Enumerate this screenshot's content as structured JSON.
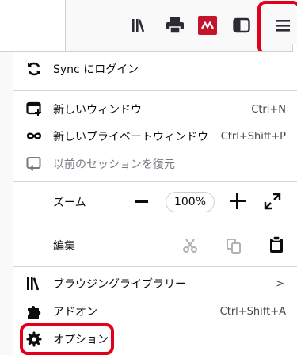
{
  "toolbar": {
    "icons": [
      "library-icon",
      "print-icon",
      "extension-badge-icon",
      "sidebar-icon",
      "hamburger-menu-icon"
    ],
    "colors": {
      "extension_badge": "#c4142c",
      "highlight": "#e0001b"
    }
  },
  "menu": {
    "sync": {
      "label": "Sync にログイン"
    },
    "new_window": {
      "label": "新しいウィンドウ",
      "shortcut": "Ctrl+N"
    },
    "new_private": {
      "label": "新しいプライベートウィンドウ",
      "shortcut": "Ctrl+Shift+P"
    },
    "restore_session": {
      "label": "以前のセッションを復元"
    },
    "zoom": {
      "label": "ズーム",
      "value": "100%"
    },
    "edit": {
      "label": "編集"
    },
    "library": {
      "label": "ブラウジングライブラリー",
      "chevron": ">"
    },
    "addons": {
      "label": "アドオン",
      "shortcut": "Ctrl+Shift+A"
    },
    "options": {
      "label": "オプション"
    }
  }
}
